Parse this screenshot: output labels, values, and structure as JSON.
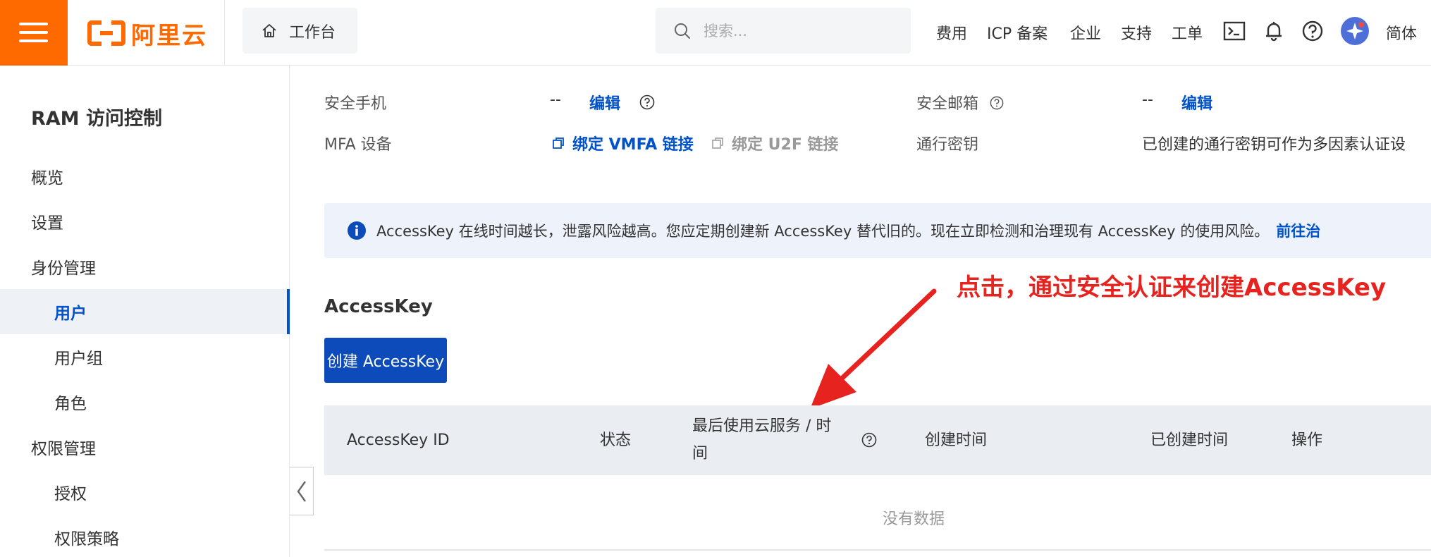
{
  "header": {
    "logo_text": "阿里云",
    "workbench_label": "工作台",
    "search_placeholder": "搜索...",
    "nav": {
      "cost": "费用",
      "icp": "ICP 备案",
      "enterprise": "企业",
      "support": "支持",
      "ticket": "工单",
      "lang": "简体"
    },
    "icons": [
      "terminal-icon",
      "bell-icon",
      "help-icon",
      "avatar"
    ],
    "accent_color": "#ff6a00"
  },
  "sidebar": {
    "title": "RAM 访问控制",
    "items": [
      {
        "label": "概览",
        "level": 1
      },
      {
        "label": "设置",
        "level": 1
      },
      {
        "label": "身份管理",
        "level": 1
      },
      {
        "label": "用户",
        "level": 2,
        "active": true
      },
      {
        "label": "用户组",
        "level": 2
      },
      {
        "label": "角色",
        "level": 2
      },
      {
        "label": "权限管理",
        "level": 1
      },
      {
        "label": "授权",
        "level": 2
      },
      {
        "label": "权限策略",
        "level": 2
      }
    ]
  },
  "security": {
    "phone_label": "安全手机",
    "phone_value": "--",
    "phone_edit": "编辑",
    "email_label": "安全邮箱",
    "email_value": "--",
    "email_edit": "编辑",
    "mfa_label": "MFA 设备",
    "mfa_vmfa": "绑定 VMFA 链接",
    "mfa_u2f": "绑定 U2F 链接",
    "passkey_label": "通行密钥",
    "passkey_value": "已创建的通行密钥可作为多因素认证设"
  },
  "alert": {
    "message": "AccessKey 在线时间越长，泄露风险越高。您应定期创建新 AccessKey 替代旧的。现在立即检测和治理现有 AccessKey 的使用风险。",
    "link": "前往治"
  },
  "annotation": {
    "text": "点击，通过安全认证来创建AccessKey",
    "color": "#e6231e"
  },
  "accesskey": {
    "section_title": "AccessKey",
    "create_button": "创建 AccessKey",
    "columns": {
      "id": "AccessKey ID",
      "status": "状态",
      "last_used_line1": "最后使用云服务 / 时",
      "last_used_line2": "间",
      "created_time": "创建时间",
      "created_ago": "已创建时间",
      "actions": "操作"
    },
    "empty_text": "没有数据"
  },
  "brand_blue": "#0052cc"
}
